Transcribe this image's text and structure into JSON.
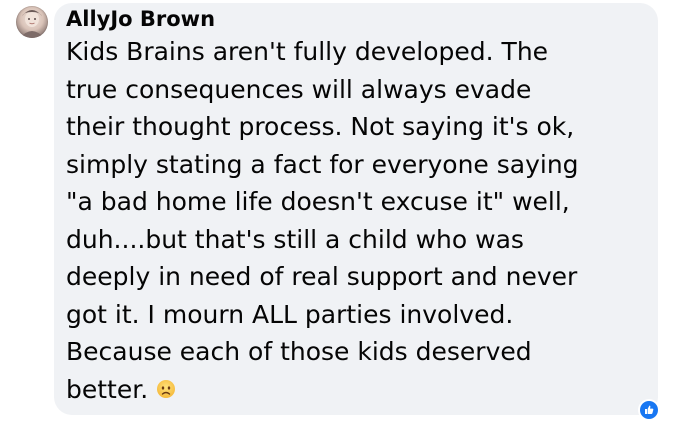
{
  "comment": {
    "author": "AllyJo Brown",
    "lines": [
      "Kids Brains aren't fully developed. The",
      "true consequences will always evade",
      "their thought process. Not saying it's ok,",
      "simply stating a fact for everyone saying",
      "\"a bad home life doesn't excuse it\" well,",
      "duh....but that's still a child who was",
      "deeply in need of real support and never",
      "got it. I mourn ALL parties involved.",
      "Because each of those kids deserved",
      "better."
    ],
    "trailing_emoji": "sad-face-emoji",
    "reaction": "like-icon"
  },
  "colors": {
    "bubble_bg": "#f0f2f5",
    "text": "#050505",
    "like_blue": "#1877f2"
  }
}
